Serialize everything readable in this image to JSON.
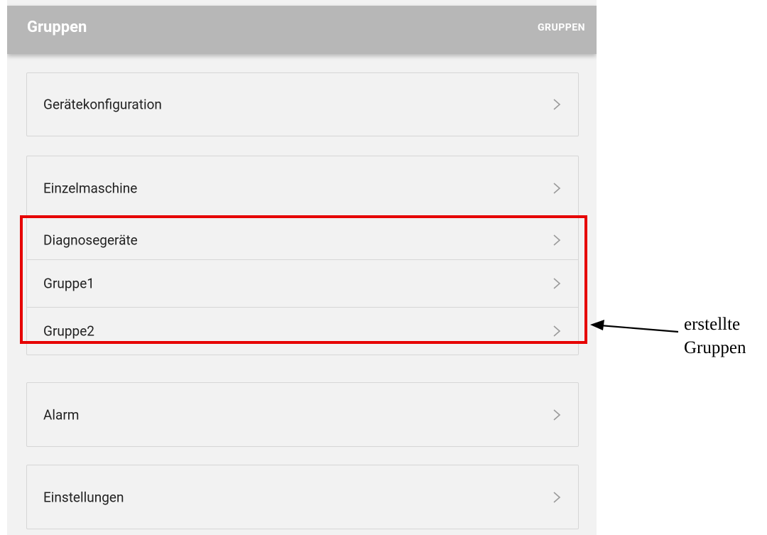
{
  "header": {
    "title": "Gruppen",
    "action_label": "GRUPPEN"
  },
  "menu": {
    "device_config": "Gerätekonfiguration",
    "single_machine": "Einzelmaschine",
    "groups": [
      "Diagnosegeräte",
      "Gruppe1",
      "Gruppe2"
    ],
    "alarm": "Alarm",
    "settings": "Einstellungen"
  },
  "annotation": {
    "line1": "erstellte",
    "line2": "Gruppen"
  },
  "colors": {
    "header_bg": "#b7b7b7",
    "highlight": "#e60000",
    "page_bg": "#f2f2f2"
  }
}
